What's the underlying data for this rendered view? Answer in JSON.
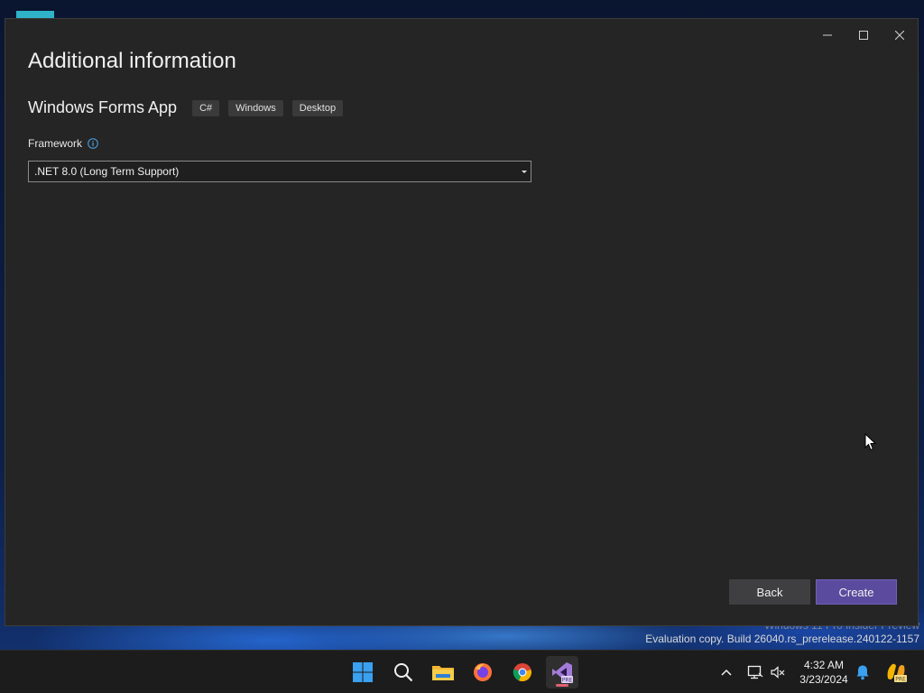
{
  "dialog": {
    "title": "Additional information",
    "template_name": "Windows Forms App",
    "tags": [
      "C#",
      "Windows",
      "Desktop"
    ],
    "framework_label": "Framework",
    "framework_value": ".NET 8.0 (Long Term Support)",
    "back_label": "Back",
    "create_label": "Create"
  },
  "desktop": {
    "watermark_line1": "Windows 11 Pro Insider Preview",
    "watermark_line2": "Evaluation copy. Build 26040.rs_prerelease.240122-1157"
  },
  "taskbar": {
    "apps": [
      "start-icon",
      "search-icon",
      "file-explorer-icon",
      "firefox-icon",
      "chrome-icon",
      "visual-studio-preview-icon"
    ],
    "time": "4:32 AM",
    "date": "3/23/2024"
  },
  "colors": {
    "dialog_bg": "#252526",
    "create_button": "#5b4b9e",
    "back_button": "#3f3f41",
    "accent_info": "#4aa3e8"
  }
}
